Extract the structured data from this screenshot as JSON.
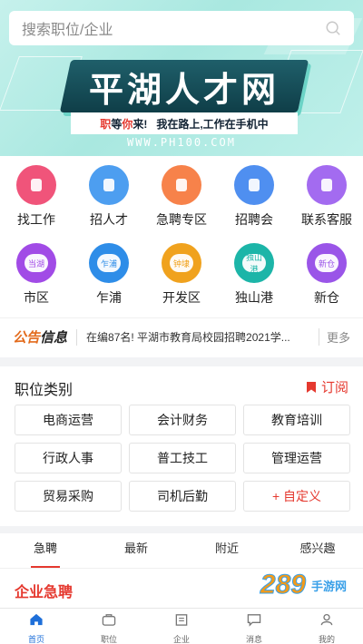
{
  "search": {
    "placeholder": "搜索职位/企业"
  },
  "banner": {
    "title": "平湖人才网",
    "slogan_left_prefix": "职",
    "slogan_left_mid": "等",
    "slogan_left_accent": "你",
    "slogan_left_end": "来!",
    "slogan_right": "我在路上,工作在手机中",
    "url": "WWW.PH100.COM"
  },
  "grid": [
    {
      "label": "找工作",
      "icon": "tie-icon",
      "color": "#f0547a",
      "glyph": ""
    },
    {
      "label": "招人才",
      "icon": "person-icon",
      "color": "#4d9ef0",
      "glyph": ""
    },
    {
      "label": "急聘专区",
      "icon": "urgent-bag-icon",
      "color": "#f7824a",
      "glyph": ""
    },
    {
      "label": "招聘会",
      "icon": "handshake-icon",
      "color": "#4f8ff0",
      "glyph": ""
    },
    {
      "label": "联系客服",
      "icon": "support-icon",
      "color": "#a36bf0",
      "glyph": ""
    },
    {
      "label": "市区",
      "icon": "area-icon",
      "color": "#a14be6",
      "glyph": "当湖"
    },
    {
      "label": "乍浦",
      "icon": "area-icon",
      "color": "#2e8de8",
      "glyph": "乍浦"
    },
    {
      "label": "开发区",
      "icon": "area-icon",
      "color": "#f0a21e",
      "glyph": "钟埭"
    },
    {
      "label": "独山港",
      "icon": "area-icon",
      "color": "#1cb5a8",
      "glyph": "独山港"
    },
    {
      "label": "新仓",
      "icon": "area-icon",
      "color": "#9a55e8",
      "glyph": "新仓"
    }
  ],
  "notice": {
    "tag_part1": "公告",
    "tag_part2": "信息",
    "text": "在编87名! 平湖市教育局校园招聘2021学...",
    "more": "更多"
  },
  "category": {
    "title": "职位类别",
    "subscribe": "订阅",
    "items": [
      "电商运营",
      "会计财务",
      "教育培训",
      "行政人事",
      "普工技工",
      "管理运营",
      "贸易采购",
      "司机后勤",
      "+ 自定义"
    ]
  },
  "tabs": [
    "急聘",
    "最新",
    "附近",
    "感兴趣"
  ],
  "urgent_title": "企业急聘",
  "watermark": {
    "num": "289",
    "site": "手游网"
  },
  "bottom_nav": [
    {
      "label": "首页",
      "icon": "home-icon"
    },
    {
      "label": "职位",
      "icon": "briefcase-icon"
    },
    {
      "label": "企业",
      "icon": "building-icon"
    },
    {
      "label": "消息",
      "icon": "message-icon"
    },
    {
      "label": "我的",
      "icon": "profile-icon"
    }
  ],
  "colors": {
    "accent": "#e5392f",
    "nav_active": "#1e6fd9"
  }
}
